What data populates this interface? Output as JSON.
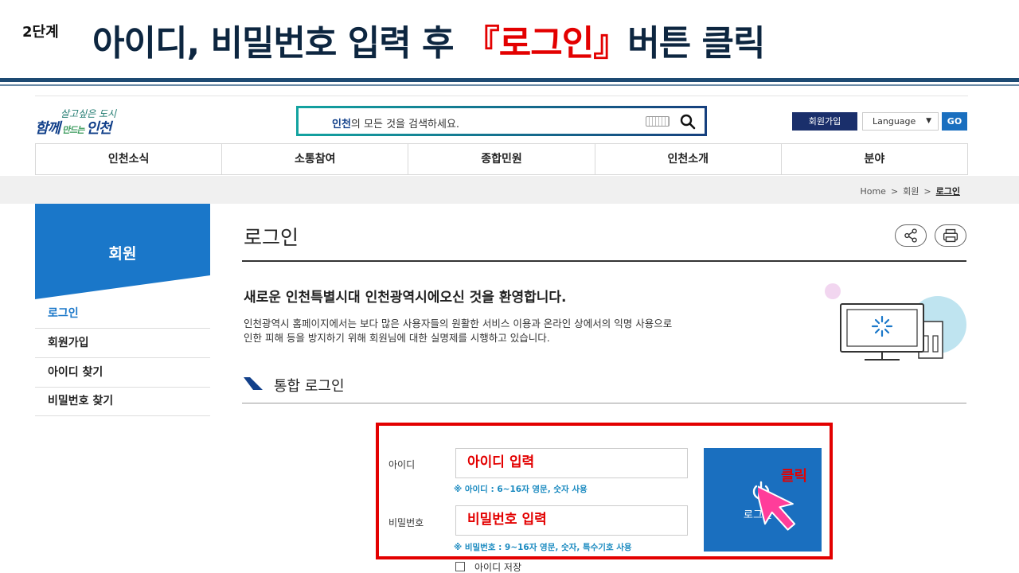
{
  "slide": {
    "step": "2단계",
    "title_before": "아이디, 비밀번호 입력 후 ",
    "title_highlight": "『로그인』",
    "title_after": "버튼 클릭",
    "highlight_color": "#e30000",
    "title_color": "#0d2640"
  },
  "header": {
    "logo_line1": "살고싶은 도시",
    "logo_line2_a": "함께",
    "logo_line2_small": " 만드는 ",
    "logo_line2_b": "인천",
    "search_keyword": "인천",
    "search_placeholder_rest": "의 모든 것을 검색하세요.",
    "icons": [
      "keyboard-icon",
      "search-icon"
    ],
    "join_label": "회원가입",
    "language_label": "Language",
    "go_label": "GO"
  },
  "nav": {
    "items": [
      "인천소식",
      "소통참여",
      "종합민원",
      "인천소개",
      "분야"
    ]
  },
  "breadcrumb": {
    "home": "Home",
    "level1": "회원",
    "current": "로그인",
    "separator": ">"
  },
  "sidebar": {
    "title": "회원",
    "items": [
      {
        "label": "로그인",
        "active": true
      },
      {
        "label": "회원가입",
        "active": false
      },
      {
        "label": "아이디 찾기",
        "active": false
      },
      {
        "label": "비밀번호 찾기",
        "active": false
      }
    ]
  },
  "content": {
    "page_title": "로그인",
    "welcome": "새로운 인천특별시대 인천광역시에오신 것을 환영합니다.",
    "desc_line1": "인천광역시 홈페이지에서는 보다 많은 사용자들의 원활한 서비스 이용과 온라인 상에서의 익명 사용으로",
    "desc_line2": "인한 피해 등을 방지하기 위해 회원님에 대한 실명제를 시행하고 있습니다.",
    "section_title": "통합 로그인"
  },
  "login_form": {
    "id_label": "아이디",
    "id_value": "아이디 입력",
    "id_hint": "※ 아이디 : 6~16자 영문, 숫자 사용",
    "pw_label": "비밀번호",
    "pw_value": "비밀번호 입력",
    "pw_hint": "※ 비밀번호 : 9~16자 영문, 숫자, 특수기호 사용",
    "login_button": "로그인",
    "click_annotation": "클릭",
    "remember_label": "아이디 저장"
  }
}
